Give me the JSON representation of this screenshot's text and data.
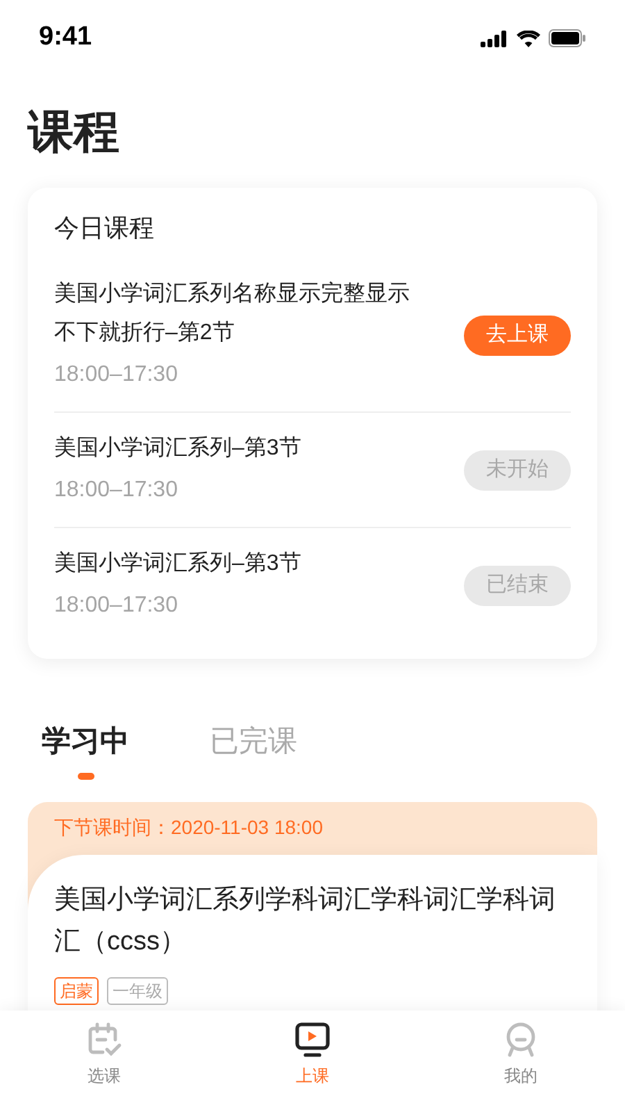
{
  "status_bar": {
    "time": "9:41"
  },
  "page_title": "课程",
  "today": {
    "title": "今日课程",
    "lessons": [
      {
        "name": "美国小学词汇系列名称显示完整显示不下就折行–第2节",
        "time": "18:00–17:30",
        "action": "去上课",
        "kind": "go"
      },
      {
        "name": "美国小学词汇系列–第3节",
        "time": "18:00–17:30",
        "action": "未开始",
        "kind": "pending"
      },
      {
        "name": "美国小学词汇系列–第3节",
        "time": "18:00–17:30",
        "action": "已结束",
        "kind": "ended"
      }
    ]
  },
  "course_tabs": [
    {
      "label": "学习中",
      "selected": true
    },
    {
      "label": "已完课",
      "selected": false
    }
  ],
  "course_card": {
    "next_lesson": "下节课时间：2020-11-03 18:00",
    "title": "美国小学词汇系列学科词汇学科词汇学科词汇（ccss）",
    "tags": [
      {
        "label": "启蒙",
        "kind": "accent"
      },
      {
        "label": "一年级",
        "kind": "plain"
      }
    ]
  },
  "bottom_nav": [
    {
      "label": "选课",
      "kind": "calendar",
      "selected": false
    },
    {
      "label": "上课",
      "kind": "screen",
      "selected": true
    },
    {
      "label": "我的",
      "kind": "person",
      "selected": false
    }
  ]
}
